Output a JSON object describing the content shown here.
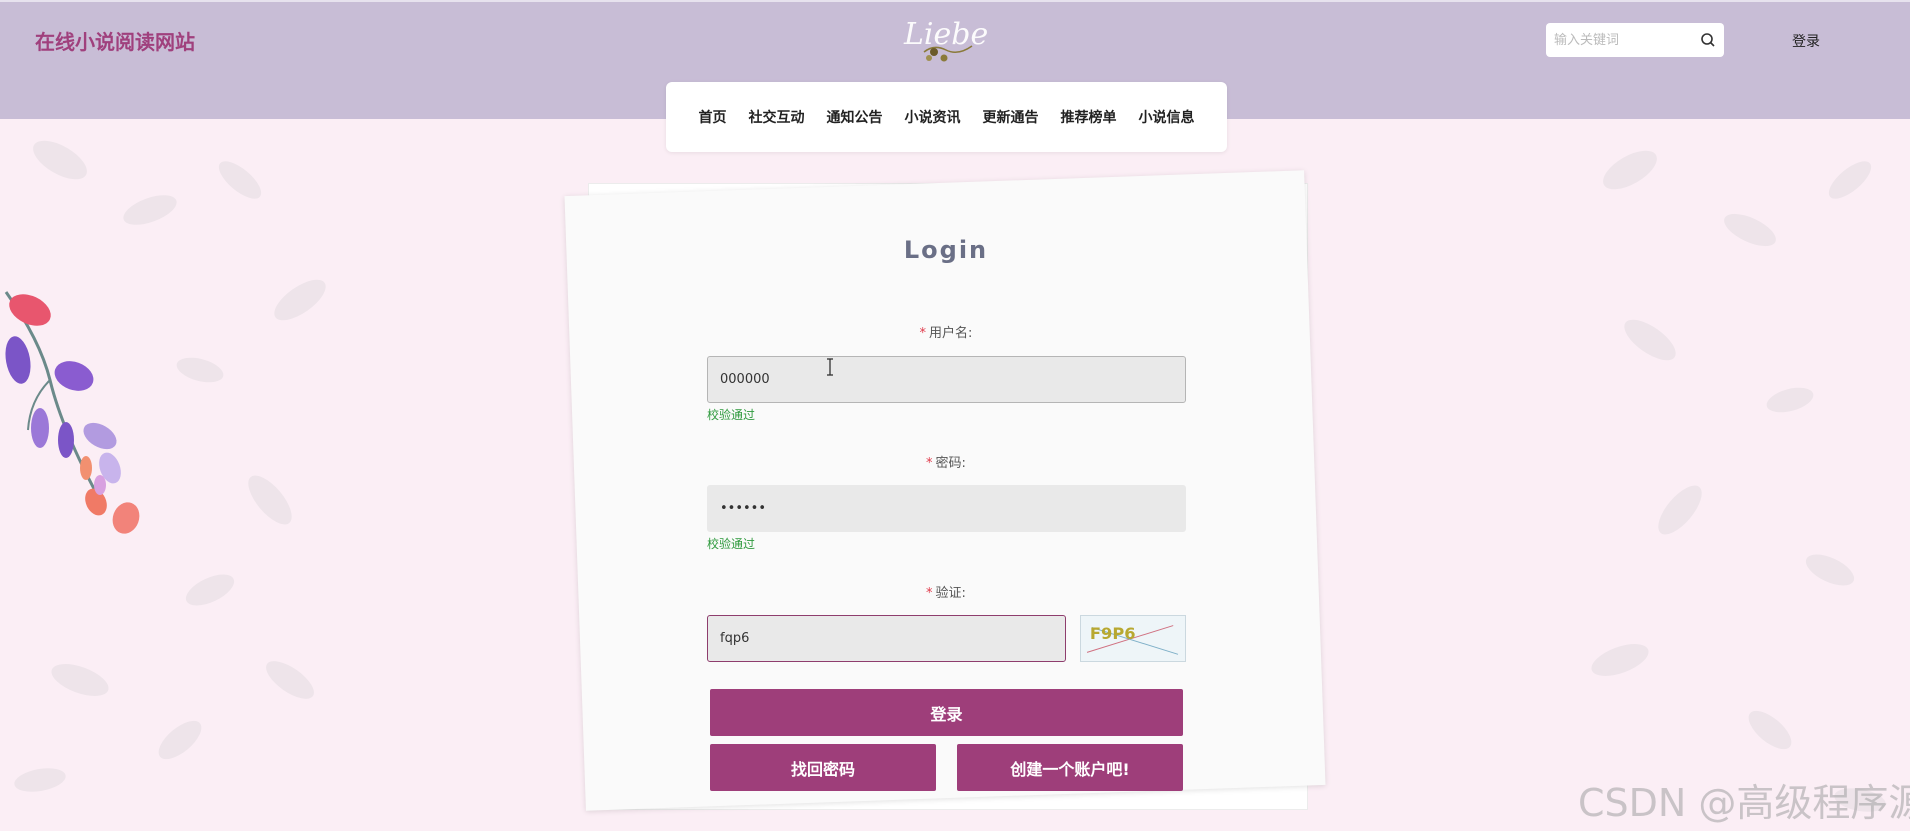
{
  "header": {
    "site_title": "在线小说阅读网站",
    "logo_text": "Liebe",
    "search_placeholder": "输入关键词",
    "login_link": "登录"
  },
  "nav": {
    "items": [
      "首页",
      "社交互动",
      "通知公告",
      "小说资讯",
      "更新通告",
      "推荐榜单",
      "小说信息"
    ]
  },
  "login_form": {
    "title": "Login",
    "required_mark": "*",
    "username_label": "用户名:",
    "username_value": "000000",
    "username_status": "校验通过",
    "password_label": "密码:",
    "password_value": "••••••",
    "password_status": "校验通过",
    "captcha_label": "验证:",
    "captcha_value": "fqp6",
    "captcha_image_text": "F9P6",
    "login_button": "登录",
    "forgot_button": "找回密码",
    "register_button": "创建一个账户吧!"
  },
  "watermark": "CSDN @高级程序源",
  "colors": {
    "header_bg": "#c8bdd6",
    "page_bg": "#fbeef5",
    "brand": "#a0407d",
    "button": "#9e3e7a",
    "valid": "#2f9a3e",
    "required": "#e0394a"
  }
}
